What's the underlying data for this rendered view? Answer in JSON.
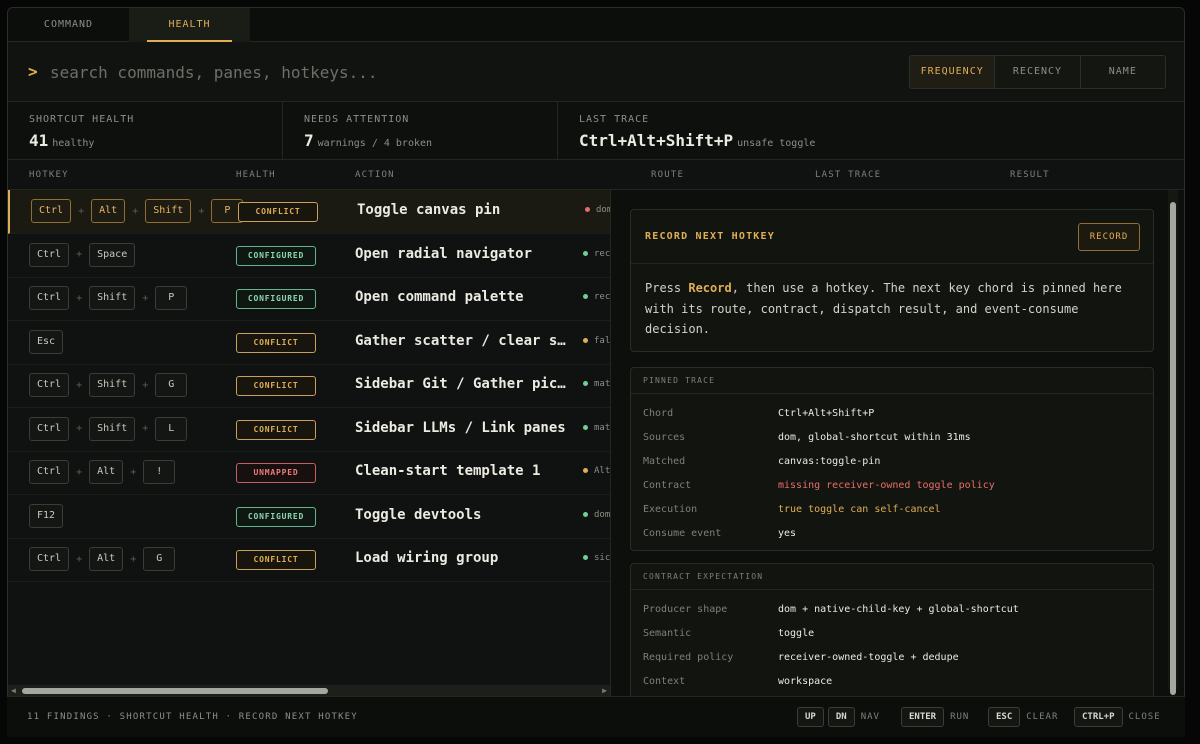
{
  "tabs": [
    {
      "label": "COMMAND",
      "active": false
    },
    {
      "label": "HEALTH",
      "active": true
    }
  ],
  "search": {
    "prompt": ">",
    "placeholder": "search commands, panes, hotkeys..."
  },
  "sort": {
    "options": [
      "FREQUENCY",
      "RECENCY",
      "NAME"
    ],
    "active": "FREQUENCY"
  },
  "stats": {
    "health": {
      "label": "SHORTCUT HEALTH",
      "value": "41",
      "sub": "healthy"
    },
    "attention": {
      "label": "NEEDS ATTENTION",
      "value": "7",
      "sub": "warnings / 4 broken"
    },
    "trace": {
      "label": "LAST TRACE",
      "value": "Ctrl+Alt+Shift+P",
      "sub": "unsafe toggle"
    }
  },
  "table": {
    "headers": {
      "hotkey": "HOTKEY",
      "health": "HEALTH",
      "action": "ACTION",
      "route": "ROUTE",
      "last_trace": "LAST TRACE",
      "result": "RESULT"
    },
    "rows": [
      {
        "keys": [
          "Ctrl",
          "Alt",
          "Shift",
          "P"
        ],
        "health": "CONFLICT",
        "action": "Toggle canvas pin",
        "route": "dom",
        "dot": "#e06c6a",
        "selected": true
      },
      {
        "keys": [
          "Ctrl",
          "Space"
        ],
        "health": "CONFIGURED",
        "action": "Open radial navigator",
        "route": "rec",
        "dot": "#6fcf97",
        "selected": false
      },
      {
        "keys": [
          "Ctrl",
          "Shift",
          "P"
        ],
        "health": "CONFIGURED",
        "action": "Open command palette",
        "route": "rec",
        "dot": "#6fcf97",
        "selected": false
      },
      {
        "keys": [
          "Esc"
        ],
        "health": "CONFLICT",
        "action": "Gather scatter / clear se…",
        "route": "fal",
        "dot": "#e0ae55",
        "selected": false
      },
      {
        "keys": [
          "Ctrl",
          "Shift",
          "G"
        ],
        "health": "CONFLICT",
        "action": "Sidebar Git / Gather pick…",
        "route": "mat",
        "dot": "#6fcf97",
        "selected": false
      },
      {
        "keys": [
          "Ctrl",
          "Shift",
          "L"
        ],
        "health": "CONFLICT",
        "action": "Sidebar LLMs / Link panes",
        "route": "mat",
        "dot": "#6fcf97",
        "selected": false
      },
      {
        "keys": [
          "Ctrl",
          "Alt",
          "!"
        ],
        "health": "UNMAPPED",
        "action": "Clean-start template 1",
        "route": "Alt",
        "dot": "#e0ae55",
        "selected": false
      },
      {
        "keys": [
          "F12"
        ],
        "health": "CONFIGURED",
        "action": "Toggle devtools",
        "route": "dom",
        "dot": "#6fcf97",
        "selected": false
      },
      {
        "keys": [
          "Ctrl",
          "Alt",
          "G"
        ],
        "health": "CONFLICT",
        "action": "Load wiring group",
        "route": "sic",
        "dot": "#6fcf97",
        "selected": false
      }
    ]
  },
  "record": {
    "title": "RECORD NEXT HOTKEY",
    "button": "RECORD",
    "text_before": "Press ",
    "text_bold": "Record",
    "text_after": ", then use a hotkey. The next key chord is pinned here with its route, contract, dispatch result, and event-consume decision."
  },
  "pinned": {
    "title": "PINNED TRACE",
    "items": [
      {
        "k": "Chord",
        "v": "Ctrl+Alt+Shift+P",
        "tone": ""
      },
      {
        "k": "Sources",
        "v": "dom, global-shortcut within 31ms",
        "tone": ""
      },
      {
        "k": "Matched",
        "v": "canvas:toggle-pin",
        "tone": ""
      },
      {
        "k": "Contract",
        "v": "missing receiver-owned toggle policy",
        "tone": "red"
      },
      {
        "k": "Execution",
        "v": "true toggle can self-cancel",
        "tone": "amber"
      },
      {
        "k": "Consume event",
        "v": "yes",
        "tone": ""
      }
    ]
  },
  "contract": {
    "title": "CONTRACT EXPECTATION",
    "items": [
      {
        "k": "Producer shape",
        "v": "dom + native-child-key + global-shortcut"
      },
      {
        "k": "Semantic",
        "v": "toggle"
      },
      {
        "k": "Required policy",
        "v": "receiver-owned-toggle + dedupe"
      },
      {
        "k": "Context",
        "v": "workspace"
      }
    ]
  },
  "footer": {
    "status": "11 FINDINGS · SHORTCUT HEALTH · RECORD NEXT HOTKEY",
    "hints": [
      {
        "keys": [
          "UP",
          "DN"
        ],
        "label": "NAV"
      },
      {
        "keys": [
          "ENTER"
        ],
        "label": "RUN"
      },
      {
        "keys": [
          "ESC"
        ],
        "label": "CLEAR"
      },
      {
        "keys": [
          "CTRL+P"
        ],
        "label": "CLOSE"
      }
    ]
  }
}
